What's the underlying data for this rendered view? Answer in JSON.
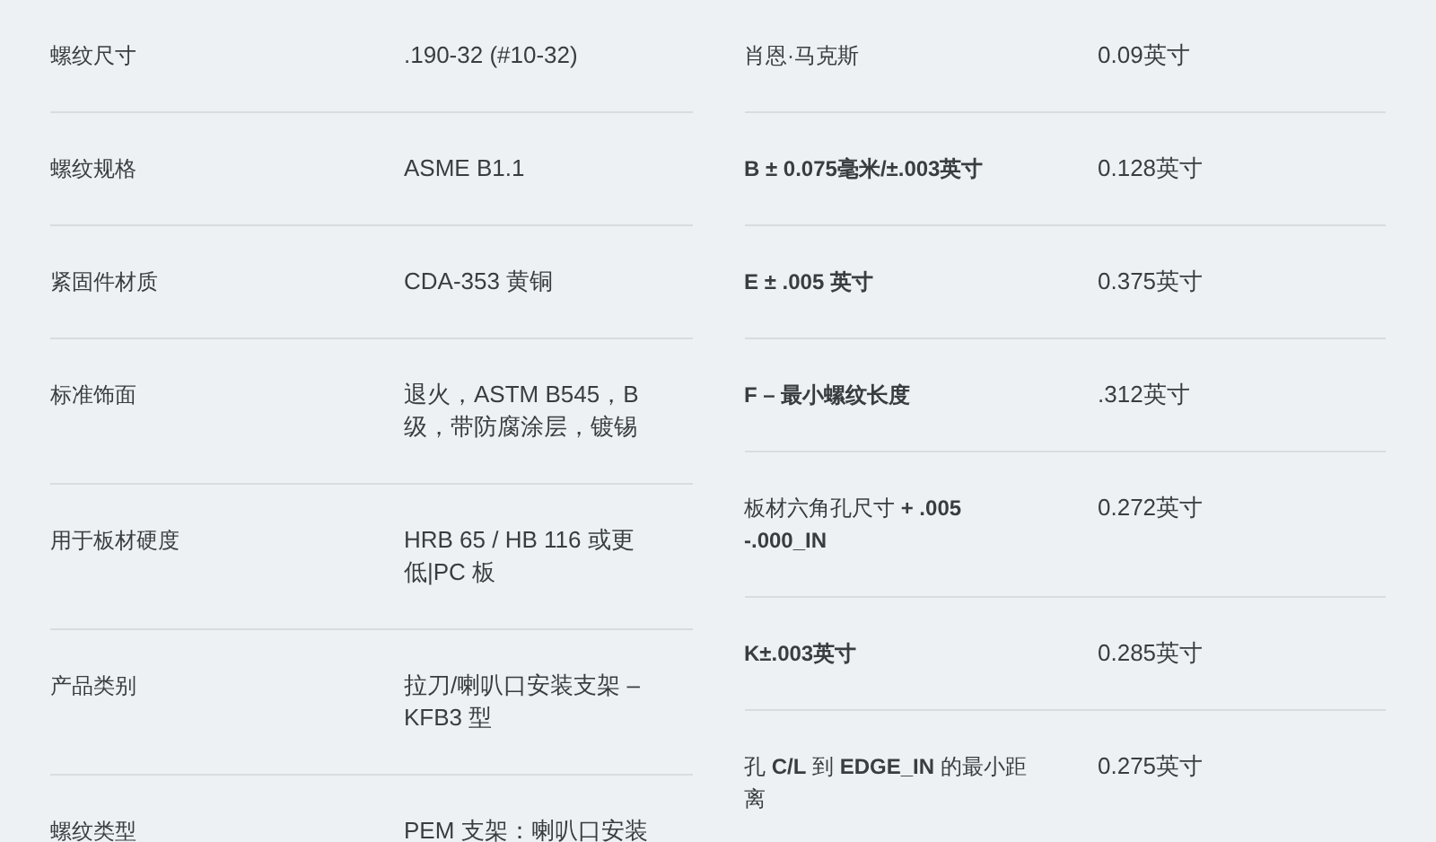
{
  "spec_tables": [
    {
      "rows": [
        {
          "label": "螺纹尺寸",
          "value": ".190-32 (#10-32)",
          "bold": false
        },
        {
          "label": "螺纹规格",
          "value": "ASME B1.1",
          "bold": false
        },
        {
          "label": "紧固件材质",
          "value": "CDA-353 黄铜",
          "bold": false
        },
        {
          "label": "标准饰面",
          "value": "退火，ASTM B545，B级，带防腐涂层，镀锡",
          "bold": false
        },
        {
          "label": "用于板材硬度",
          "value": "HRB 65 / HB 116 或更低|PC 板",
          "bold": false
        },
        {
          "label": "产品类别",
          "value": "拉刀/喇叭口安装支架 – KFB3 型",
          "bold": false
        },
        {
          "label": "螺纹类型",
          "value": "PEM 支架：喇叭口安装",
          "bold": false
        }
      ]
    },
    {
      "rows": [
        {
          "label": "肖恩·马克斯",
          "value": "0.09英寸",
          "bold": false
        },
        {
          "label": "B ± 0.075毫米/±.003英寸",
          "value": "0.128英寸",
          "bold": true
        },
        {
          "label": "E ± .005 英寸",
          "value": "0.375英寸",
          "bold": true
        },
        {
          "label": "F – 最小螺纹长度",
          "value": ".312英寸",
          "bold": true
        },
        {
          "label": "板材六角孔尺寸 **+ .005 -.000_IN**",
          "value": "0.272英寸",
          "bold": false
        },
        {
          "label": "K±.003英寸",
          "value": "0.285英寸",
          "bold": true
        },
        {
          "label": "孔 **C/L** 到 **EDGE_IN** 的最小距离",
          "value": "0.275英寸",
          "bold": false
        }
      ]
    }
  ]
}
